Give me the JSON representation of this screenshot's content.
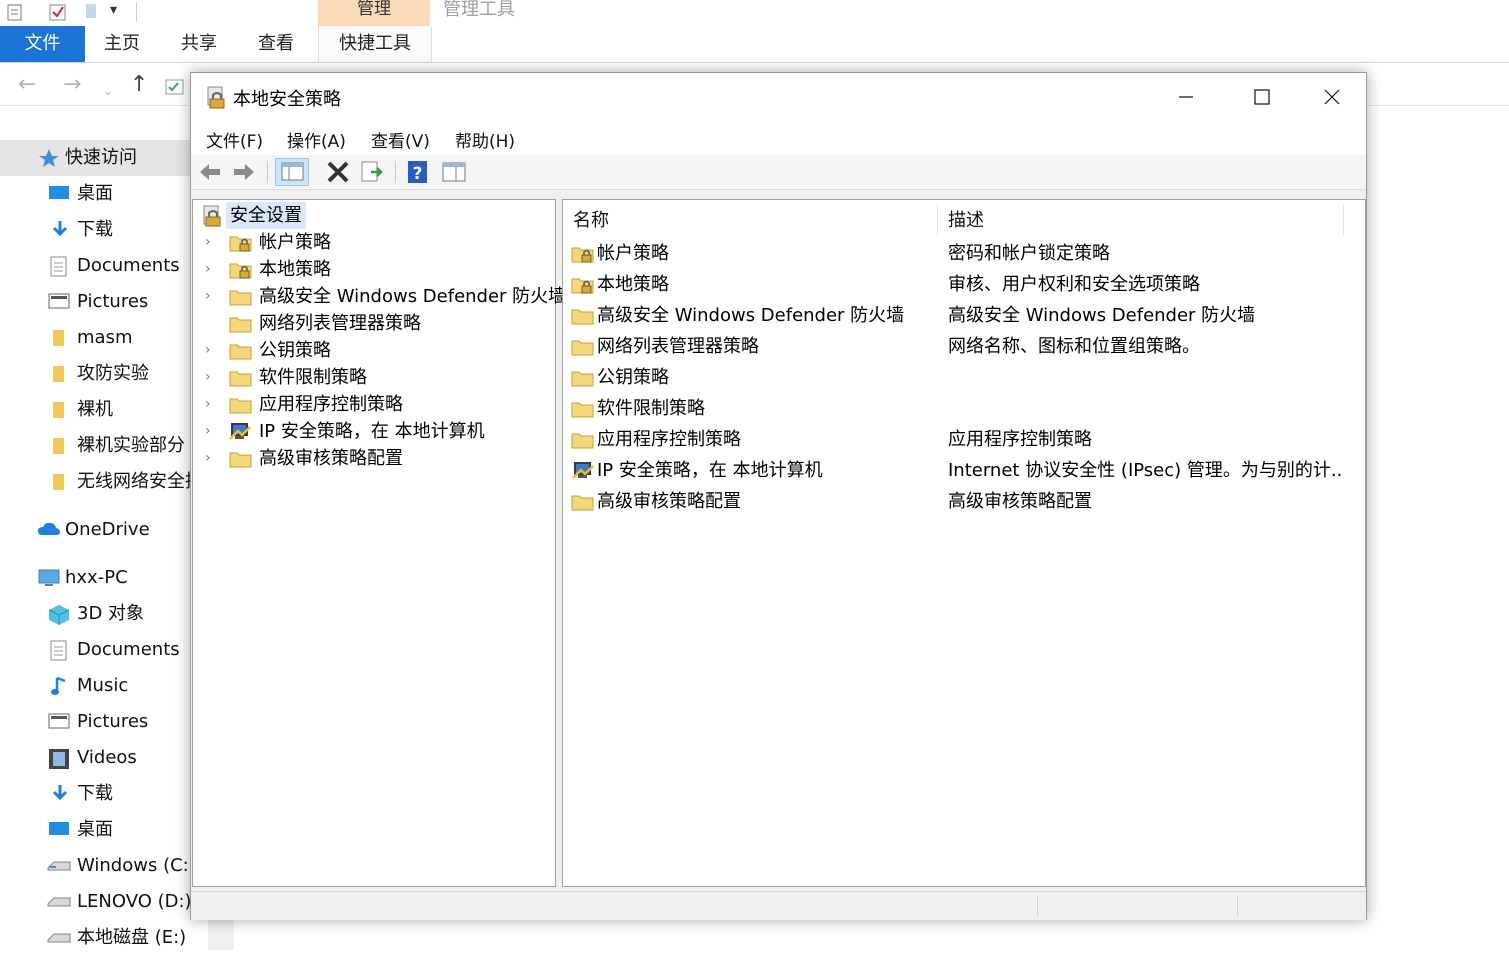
{
  "explorer": {
    "ribbon": {
      "context_tab_header": "管理",
      "context_group_label": "管理工具",
      "tabs": [
        {
          "label": "文件"
        },
        {
          "label": "主页"
        },
        {
          "label": "共享"
        },
        {
          "label": "查看"
        },
        {
          "label": "快捷工具"
        }
      ]
    },
    "nav_pane": {
      "quick_access": "快速访问",
      "quick_items": [
        {
          "label": "桌面",
          "icon": "desktop-icon"
        },
        {
          "label": "下载",
          "icon": "download-icon"
        },
        {
          "label": "Documents",
          "icon": "documents-icon"
        },
        {
          "label": "Pictures",
          "icon": "pictures-icon"
        },
        {
          "label": "masm",
          "icon": "folder-icon"
        },
        {
          "label": "攻防实验",
          "icon": "folder-icon"
        },
        {
          "label": "裸机",
          "icon": "folder-icon"
        },
        {
          "label": "裸机实验部分",
          "icon": "folder-icon"
        },
        {
          "label": "无线网络安全技",
          "icon": "folder-icon"
        }
      ],
      "onedrive": "OneDrive",
      "this_pc": "hxx-PC",
      "pc_items": [
        {
          "label": "3D 对象",
          "icon": "3d-objects-icon"
        },
        {
          "label": "Documents",
          "icon": "documents-icon"
        },
        {
          "label": "Music",
          "icon": "music-icon"
        },
        {
          "label": "Pictures",
          "icon": "pictures-icon"
        },
        {
          "label": "Videos",
          "icon": "videos-icon"
        },
        {
          "label": "下载",
          "icon": "download-icon"
        },
        {
          "label": "桌面",
          "icon": "desktop-icon"
        },
        {
          "label": "Windows (C:)",
          "icon": "drive-icon"
        },
        {
          "label": "LENOVO (D:)",
          "icon": "drive-icon"
        },
        {
          "label": "本地磁盘 (E:)",
          "icon": "drive-icon"
        }
      ]
    }
  },
  "secpol": {
    "title": "本地安全策略",
    "menus": [
      {
        "label": "文件(F)"
      },
      {
        "label": "操作(A)"
      },
      {
        "label": "查看(V)"
      },
      {
        "label": "帮助(H)"
      }
    ],
    "tree": {
      "root": "安全设置",
      "children": [
        {
          "label": "帐户策略",
          "icon": "lock-folder-icon",
          "expandable": true
        },
        {
          "label": "本地策略",
          "icon": "lock-folder-icon",
          "expandable": true
        },
        {
          "label": "高级安全 Windows Defender 防火墙",
          "icon": "folder-icon",
          "expandable": true
        },
        {
          "label": "网络列表管理器策略",
          "icon": "folder-icon",
          "expandable": false
        },
        {
          "label": "公钥策略",
          "icon": "folder-icon",
          "expandable": true
        },
        {
          "label": "软件限制策略",
          "icon": "folder-icon",
          "expandable": true
        },
        {
          "label": "应用程序控制策略",
          "icon": "folder-icon",
          "expandable": true
        },
        {
          "label": "IP 安全策略，在 本地计算机",
          "icon": "ipsec-icon",
          "expandable": true
        },
        {
          "label": "高级审核策略配置",
          "icon": "folder-icon",
          "expandable": true
        }
      ]
    },
    "list": {
      "col_name": "名称",
      "col_desc": "描述",
      "rows": [
        {
          "name": "帐户策略",
          "desc": "密码和帐户锁定策略",
          "icon": "lock-folder-icon"
        },
        {
          "name": "本地策略",
          "desc": "审核、用户权利和安全选项策略",
          "icon": "lock-folder-icon"
        },
        {
          "name": "高级安全 Windows Defender 防火墙",
          "desc": "高级安全 Windows Defender 防火墙",
          "icon": "folder-icon"
        },
        {
          "name": "网络列表管理器策略",
          "desc": "网络名称、图标和位置组策略。",
          "icon": "folder-icon"
        },
        {
          "name": "公钥策略",
          "desc": "",
          "icon": "folder-icon"
        },
        {
          "name": "软件限制策略",
          "desc": "",
          "icon": "folder-icon"
        },
        {
          "name": "应用程序控制策略",
          "desc": "应用程序控制策略",
          "icon": "folder-icon"
        },
        {
          "name": "IP 安全策略，在 本地计算机",
          "desc": "Internet 协议安全性 (IPsec) 管理。为与别的计...",
          "icon": "ipsec-icon"
        },
        {
          "name": "高级审核策略配置",
          "desc": "高级审核策略配置",
          "icon": "folder-icon"
        }
      ]
    }
  }
}
